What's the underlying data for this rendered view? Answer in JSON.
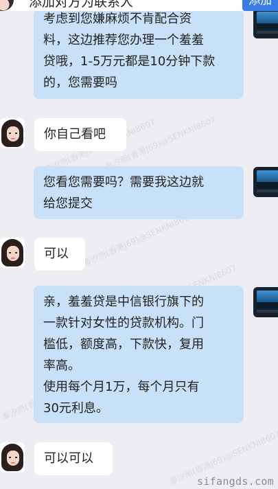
{
  "header": {
    "title": "添加对方为联系人",
    "add_button": "添加"
  },
  "messages": [
    {
      "sender": "self",
      "lines": [
        "考虑到您嫌麻烦不肯配合资",
        "料，这边推荐您办理一个羞羞",
        "贷哦，1-5万元都是10分钟下款",
        "的，您需要吗"
      ]
    },
    {
      "sender": "contact",
      "lines": [
        "你自己看吧"
      ]
    },
    {
      "sender": "self",
      "lines": [
        "您看您需要吗？需要我这边就",
        "给您提交"
      ]
    },
    {
      "sender": "contact",
      "lines": [
        "可以"
      ]
    },
    {
      "sender": "self",
      "lines": [
        "亲，羞羞贷是中信银行旗下的",
        "一款针对女性的贷款机构。门",
        "槛低，额度高，下款快，复用",
        "率高。",
        "使用每个月1万，每个月只有",
        "30元利息。"
      ]
    },
    {
      "sender": "contact",
      "lines": [
        "可以可以"
      ]
    }
  ],
  "watermarks": [
    "秦汐雨(香港J69)@SENKNI8607",
    "秦汐雨(香港J69)@SENKNI8607",
    "秦汐雨(香港J69)@SENKNI8607",
    "秦汐雨(香港J69)@SENKNI8607",
    "秦汐雨(香港J69)@SENKNI8607",
    "秦汐雨(香港J69)@SENKNI8607"
  ],
  "site_watermark": "sifangds.com",
  "colors": {
    "background": "#ededf2",
    "outgoing_bubble": "#c8e0f8",
    "incoming_bubble": "#ffffff",
    "add_button": "#3a7de2"
  },
  "icons": {
    "contact_avatar": "woman-portrait-avatar",
    "self_avatar": "monitor-landscape-avatar"
  }
}
